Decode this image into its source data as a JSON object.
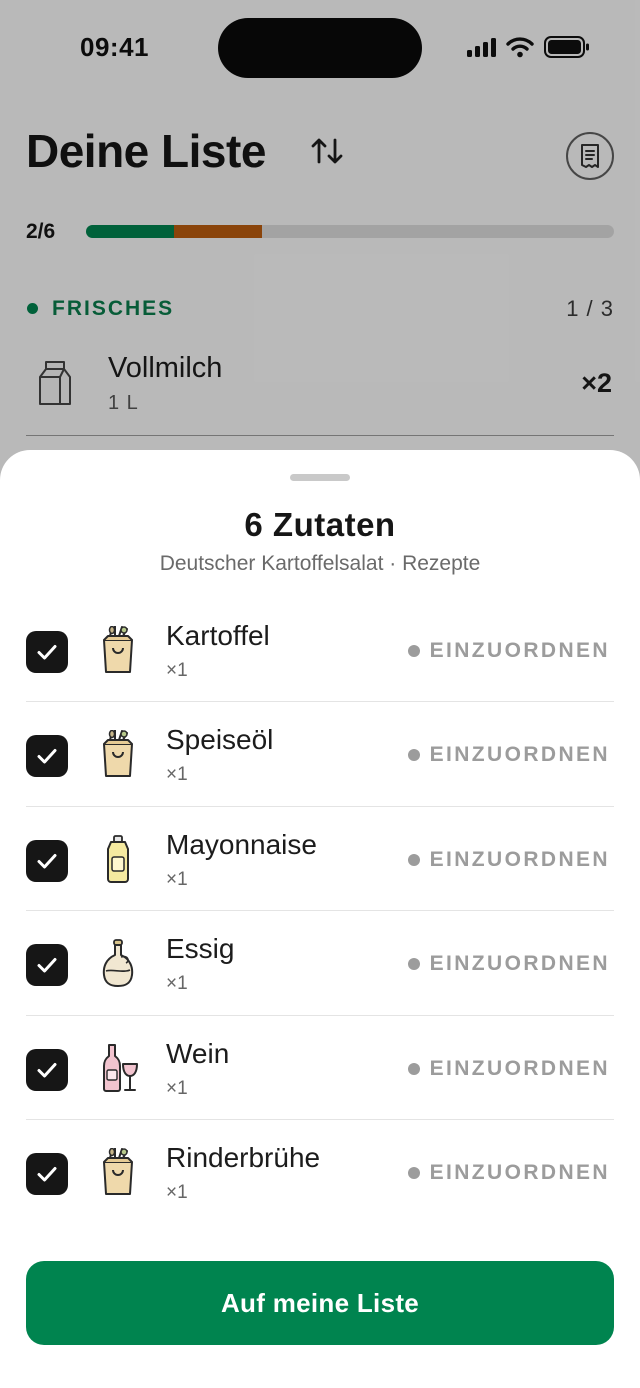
{
  "status_bar": {
    "time": "09:41"
  },
  "header": {
    "title": "Deine Liste"
  },
  "progress": {
    "label": "2/6",
    "checked_fraction": 0.1667,
    "pending_fraction": 0.1667,
    "colors": {
      "checked": "#00804d",
      "pending": "#b65a0e",
      "track": "#d7d7d7"
    }
  },
  "section": {
    "title": "FRISCHES",
    "count": "1 / 3",
    "color": "#0a7a4a"
  },
  "background_item": {
    "name": "Vollmilch",
    "quantity": "1 L",
    "multiplier": "×2",
    "icon": "milk-carton-icon"
  },
  "sheet": {
    "title": "6 Zutaten",
    "subtitle": "Deutscher Kartoffelsalat · Rezepte",
    "status_label": "EINZUORDNEN",
    "items": [
      {
        "name": "Kartoffel",
        "qty": "×1",
        "icon": "grocery-bag-icon",
        "checked": true
      },
      {
        "name": "Speiseöl",
        "qty": "×1",
        "icon": "grocery-bag-icon",
        "checked": true
      },
      {
        "name": "Mayonnaise",
        "qty": "×1",
        "icon": "mayonnaise-bottle-icon",
        "checked": true
      },
      {
        "name": "Essig",
        "qty": "×1",
        "icon": "vinegar-carafe-icon",
        "checked": true
      },
      {
        "name": "Wein",
        "qty": "×1",
        "icon": "wine-bottle-glass-icon",
        "checked": true
      },
      {
        "name": "Rinderbrühe",
        "qty": "×1",
        "icon": "grocery-bag-icon",
        "checked": true
      }
    ],
    "cta_label": "Auf meine Liste",
    "accent": "#00844f"
  }
}
